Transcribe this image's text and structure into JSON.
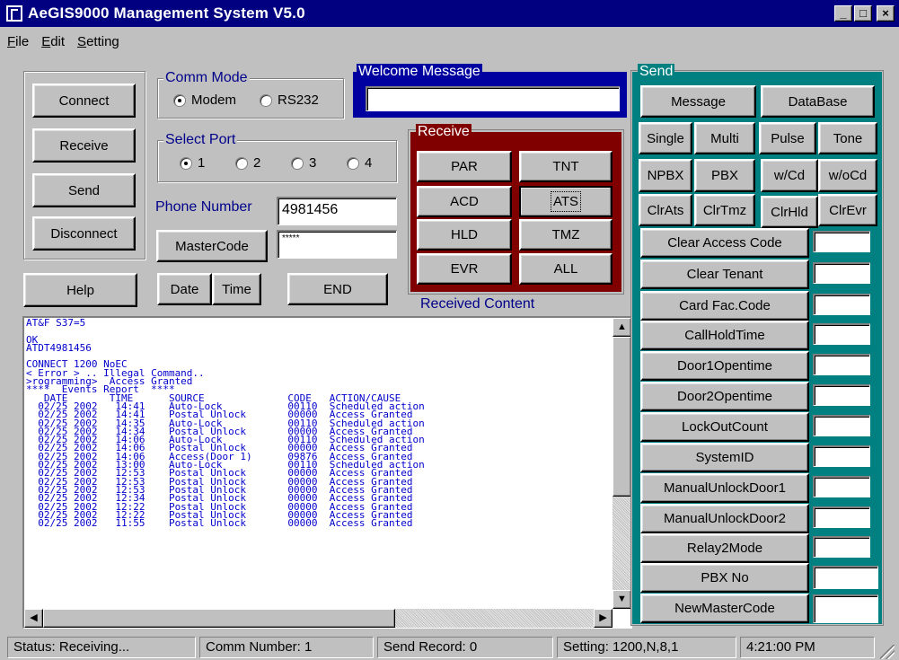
{
  "window": {
    "title": "AeGIS9000 Management System V5.0",
    "min_glyph": "_",
    "max_glyph": "□",
    "close_glyph": "×"
  },
  "menu": [
    {
      "label": "File",
      "u": "F",
      "rest": "ile"
    },
    {
      "label": "Edit",
      "u": "E",
      "rest": "dit"
    },
    {
      "label": "Setting",
      "u": "S",
      "rest": "etting"
    }
  ],
  "left_buttons": {
    "connect": "Connect",
    "receive": "Receive",
    "send": "Send",
    "disconnect": "Disconnect",
    "help": "Help"
  },
  "comm_mode": {
    "label": "Comm Mode",
    "options": [
      "Modem",
      "RS232"
    ],
    "selected": "Modem"
  },
  "select_port": {
    "label": "Select Port",
    "options": [
      "1",
      "2",
      "3",
      "4"
    ],
    "selected": "1"
  },
  "phone": {
    "label": "Phone Number",
    "value": "4981456"
  },
  "master_code": {
    "button": "MasterCode",
    "value": "*****"
  },
  "date_button": "Date",
  "time_button": "Time",
  "end_button": "END",
  "welcome": {
    "label": "Welcome Message",
    "value": ""
  },
  "receive": {
    "label": "Receive",
    "buttons": [
      "PAR",
      "TNT",
      "ACD",
      "ATS",
      "HLD",
      "TMZ",
      "EVR",
      "ALL"
    ],
    "focused": "ATS",
    "content_label": "Received Content"
  },
  "log_lines": [
    "AT&F S37=5",
    "",
    "OK",
    "ATDT4981456",
    "",
    "CONNECT 1200 NoEC",
    "< Error > .. Illegal Command..",
    ">rogramming>  Access Granted",
    "****  Events Report  ****",
    "   DATE       TIME      SOURCE              CODE   ACTION/CAUSE",
    "  02/25 2002   14:41    Auto-Lock           00110  Scheduled action",
    "  02/25 2002   14:41    Postal Unlock       00000  Access Granted",
    "  02/25 2002   14:35    Auto-Lock           00110  Scheduled action",
    "  02/25 2002   14:34    Postal Unlock       00000  Access Granted",
    "  02/25 2002   14:06    Auto-Lock           00110  Scheduled action",
    "  02/25 2002   14:06    Postal Unlock       00000  Access Granted",
    "  02/25 2002   14:06    Access(Door 1)      09876  Access Granted",
    "  02/25 2002   13:00    Auto-Lock           00110  Scheduled action",
    "  02/25 2002   12:53    Postal Unlock       00000  Access Granted",
    "  02/25 2002   12:53    Postal Unlock       00000  Access Granted",
    "  02/25 2002   12:53    Postal Unlock       00000  Access Granted",
    "  02/25 2002   12:34    Postal Unlock       00000  Access Granted",
    "  02/25 2002   12:22    Postal Unlock       00000  Access Granted",
    "  02/25 2002   12:22    Postal Unlock       00000  Access Granted",
    "  02/25 2002   11:55    Postal Unlock       00000  Access Granted"
  ],
  "send": {
    "label": "Send",
    "message": "Message",
    "database": "DataBase",
    "single": "Single",
    "multi": "Multi",
    "pulse": "Pulse",
    "tone": "Tone",
    "npbx": "NPBX",
    "pbx": "PBX",
    "wcd": "w/Cd",
    "wocd": "w/oCd",
    "clrats": "ClrAts",
    "clrtmz": "ClrTmz",
    "clrhld": "ClrHld",
    "clrevr": "ClrEvr",
    "params": [
      {
        "label": "Clear Access Code",
        "value": ""
      },
      {
        "label": "Clear Tenant",
        "value": ""
      },
      {
        "label": "Card Fac.Code",
        "value": ""
      },
      {
        "label": "CallHoldTime",
        "value": ""
      },
      {
        "label": "Door1Opentime",
        "value": ""
      },
      {
        "label": "Door2Opentime",
        "value": ""
      },
      {
        "label": "LockOutCount",
        "value": ""
      },
      {
        "label": "SystemID",
        "value": ""
      },
      {
        "label": "ManualUnlockDoor1",
        "value": ""
      },
      {
        "label": "ManualUnlockDoor2",
        "value": ""
      },
      {
        "label": "Relay2Mode",
        "value": ""
      },
      {
        "label": "PBX No",
        "value": ""
      },
      {
        "label": "NewMasterCode",
        "value": ""
      }
    ]
  },
  "status": {
    "status": "Status: Receiving...",
    "comm_number": "Comm Number: 1",
    "send_record": "Send Record: 0",
    "setting": "Setting: 1200,N,8,1",
    "time": "4:21:00 PM"
  },
  "colors": {
    "titlebar": "#000080",
    "receive_panel": "#800000",
    "send_panel": "#008080",
    "welcome_panel": "#0000a0",
    "log_text": "#0000cc"
  }
}
